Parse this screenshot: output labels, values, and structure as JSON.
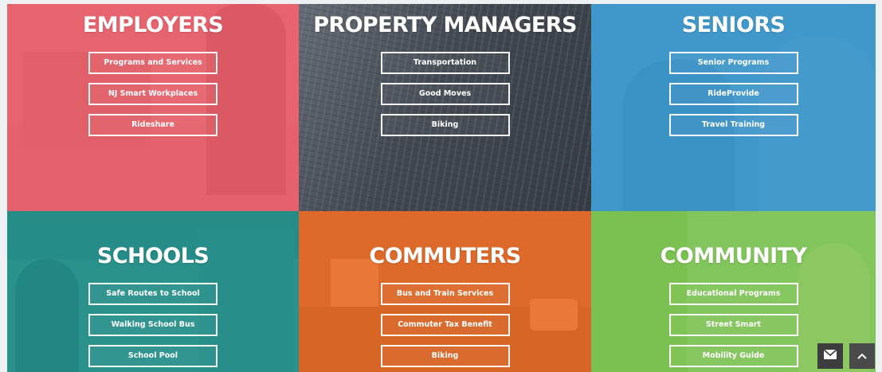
{
  "tiles": [
    {
      "title": "EMPLOYERS",
      "buttons": [
        "Programs and Services",
        "NJ Smart Workplaces",
        "Rideshare"
      ]
    },
    {
      "title": "PROPERTY MANAGERS",
      "buttons": [
        "Transportation",
        "Good Moves",
        "Biking"
      ]
    },
    {
      "title": "SENIORS",
      "buttons": [
        "Senior Programs",
        "RideProvide",
        "Travel Training"
      ]
    },
    {
      "title": "SCHOOLS",
      "buttons": [
        "Safe Routes to School",
        "Walking School Bus",
        "School Pool"
      ]
    },
    {
      "title": "COMMUTERS",
      "buttons": [
        "Bus and Train Services",
        "Commuter Tax Benefit",
        "Biking"
      ]
    },
    {
      "title": "COMMUNITY",
      "buttons": [
        "Educational Programs",
        "Street Smart",
        "Mobility Guide"
      ]
    }
  ],
  "colors": {
    "employers": "#e8525e",
    "property_managers": "#3c424a",
    "seniors": "#2c8fc8",
    "schools": "#1e918c",
    "commuters": "#eb681e",
    "community": "#76c44a"
  },
  "floating": {
    "mail_icon": "envelope-icon",
    "up_icon": "chevron-up-icon"
  }
}
